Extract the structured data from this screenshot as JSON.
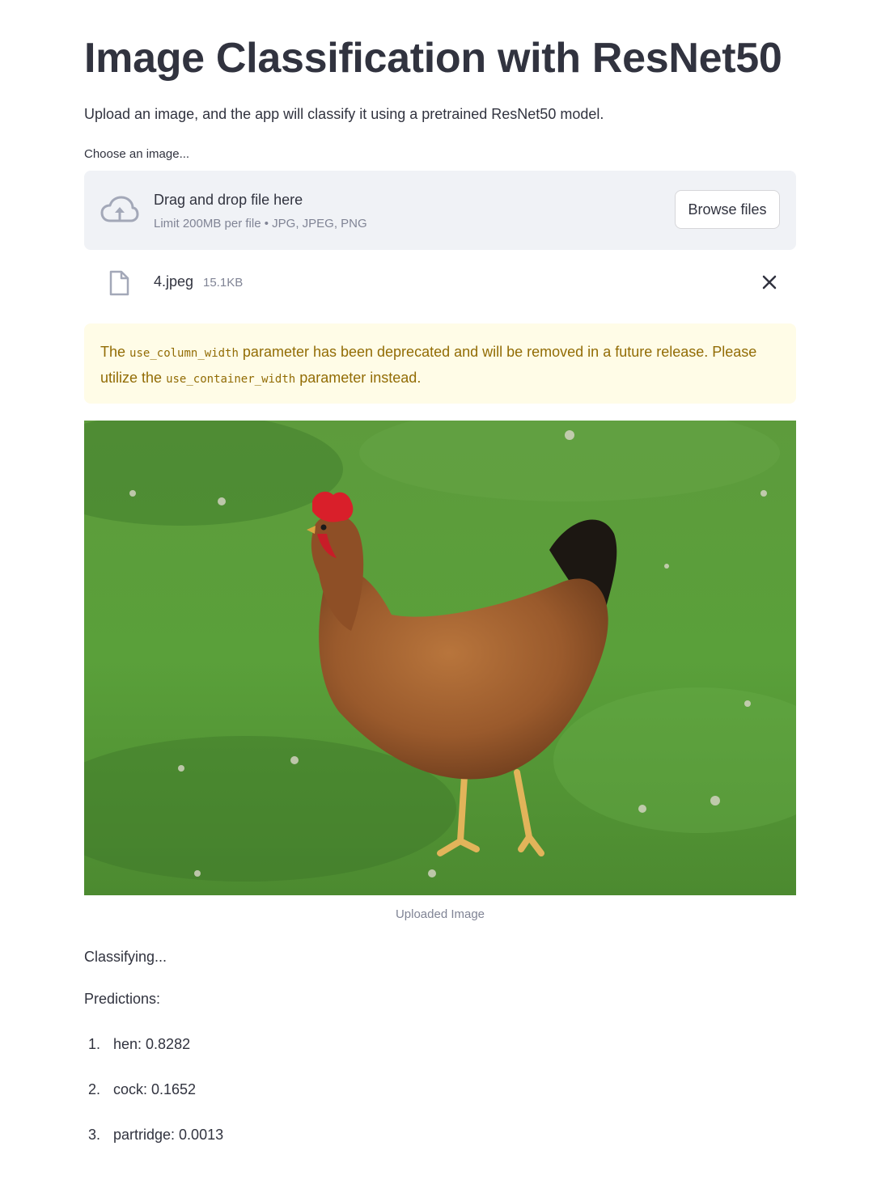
{
  "page": {
    "title": "Image Classification with ResNet50",
    "intro": "Upload an image, and the app will classify it using a pretrained ResNet50 model."
  },
  "uploader": {
    "label": "Choose an image...",
    "drop_title": "Drag and drop file here",
    "drop_subtitle": "Limit 200MB per file • JPG, JPEG, PNG",
    "browse_label": "Browse files",
    "cloud_icon": "cloud-upload-icon"
  },
  "file": {
    "name": "4.jpeg",
    "size": "15.1KB",
    "icon": "file-icon",
    "remove_icon": "close-icon"
  },
  "warning": {
    "prefix": "The",
    "code1": "use_column_width",
    "middle": "parameter has been deprecated and will be removed in a future release. Please utilize the",
    "code2": "use_container_width",
    "suffix": "parameter instead."
  },
  "image": {
    "caption": "Uploaded Image"
  },
  "status": "Classifying...",
  "predictions": {
    "heading": "Predictions:",
    "items": [
      {
        "num": "1.",
        "text": "hen: 0.8282"
      },
      {
        "num": "2.",
        "text": "cock: 0.1652"
      },
      {
        "num": "3.",
        "text": "partridge: 0.0013"
      }
    ]
  },
  "colors": {
    "text": "#31333f",
    "muted": "#808495",
    "dropzone_bg": "#f0f2f6",
    "warning_bg": "#fffce7",
    "warning_text": "#926c05"
  }
}
